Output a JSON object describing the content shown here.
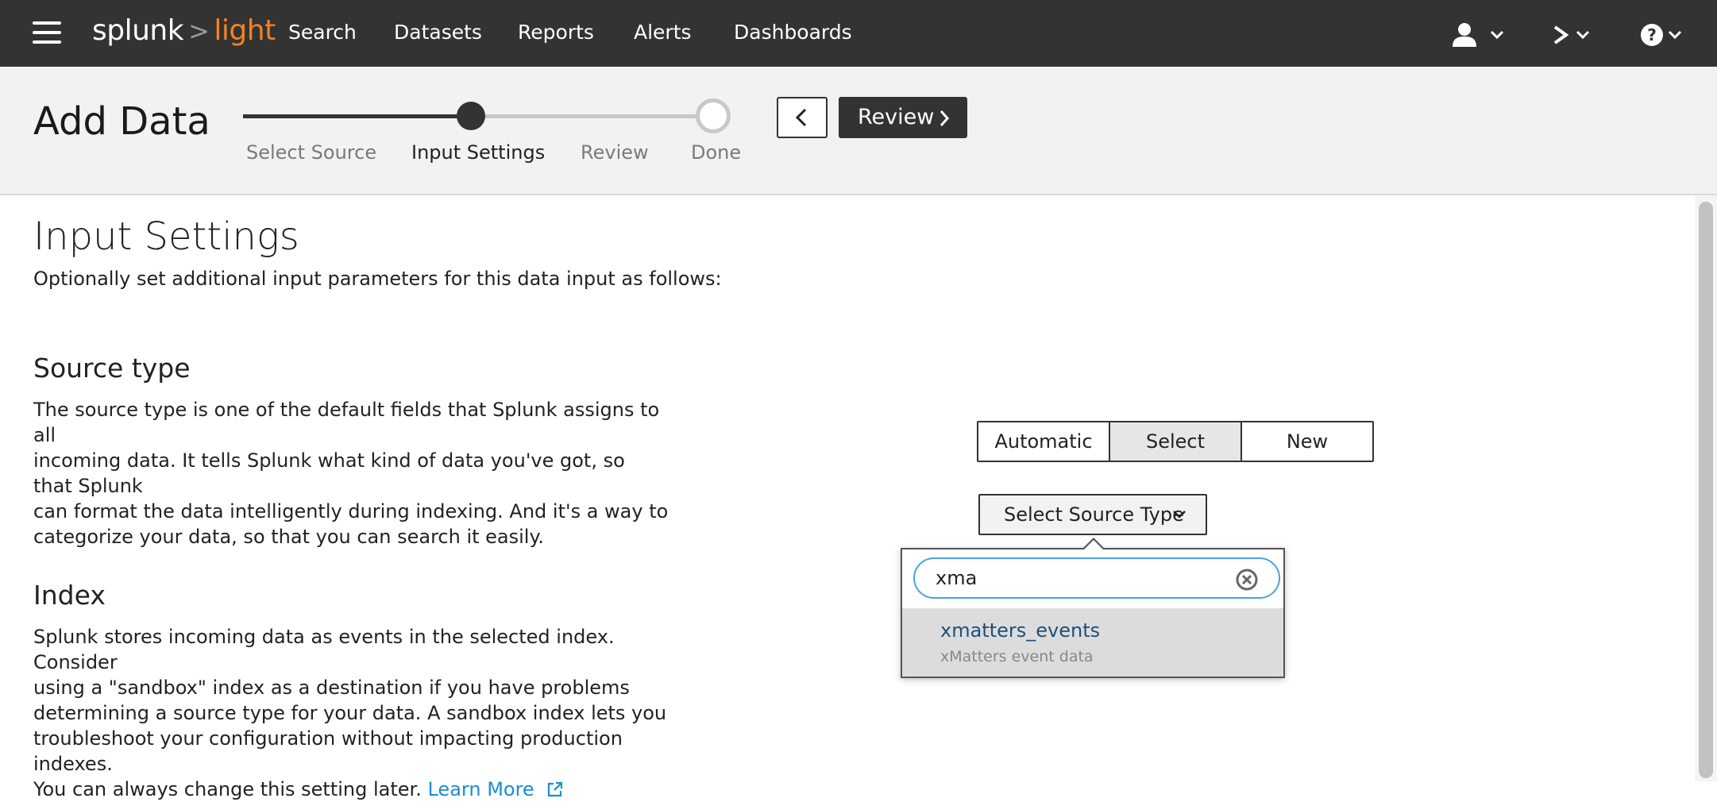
{
  "topbar": {
    "brand_main": "splunk",
    "brand_sep": ">",
    "brand_product": "light",
    "nav": [
      "Search",
      "Datasets",
      "Reports",
      "Alerts",
      "Dashboards"
    ]
  },
  "header": {
    "title": "Add Data",
    "steps": [
      "Select Source",
      "Input Settings",
      "Review",
      "Done"
    ],
    "active_step": 1,
    "review_label": "Review"
  },
  "main": {
    "heading": "Input Settings",
    "lead": "Optionally set additional input parameters for this data input as follows:",
    "source_type": {
      "heading": "Source type",
      "lines": [
        "The source type is one of the default fields that Splunk assigns to all",
        "incoming data. It tells Splunk what kind of data you've got, so that Splunk",
        "can format the data intelligently during indexing. And it's a way to",
        "categorize your data, so that you can search it easily."
      ],
      "modes": [
        "Automatic",
        "Select",
        "New"
      ],
      "selected_mode": "Select",
      "dropdown_label": "Select Source Type",
      "search_value": "xma",
      "results": [
        {
          "name": "xmatters_events",
          "description": "xMatters event data"
        }
      ]
    },
    "index": {
      "heading": "Index",
      "lines": [
        "Splunk stores incoming data as events in the selected index. Consider",
        "using a \"sandbox\" index as a destination if you have problems",
        "determining a source type for your data. A sandbox index lets you",
        "troubleshoot your configuration without impacting production indexes.",
        "You can always change this setting later."
      ],
      "learn_more": "Learn More"
    }
  },
  "colors": {
    "topbar": "#333333",
    "brand_accent": "#f58220",
    "link": "#1a8fd0",
    "search_focus": "#4aa3df"
  }
}
